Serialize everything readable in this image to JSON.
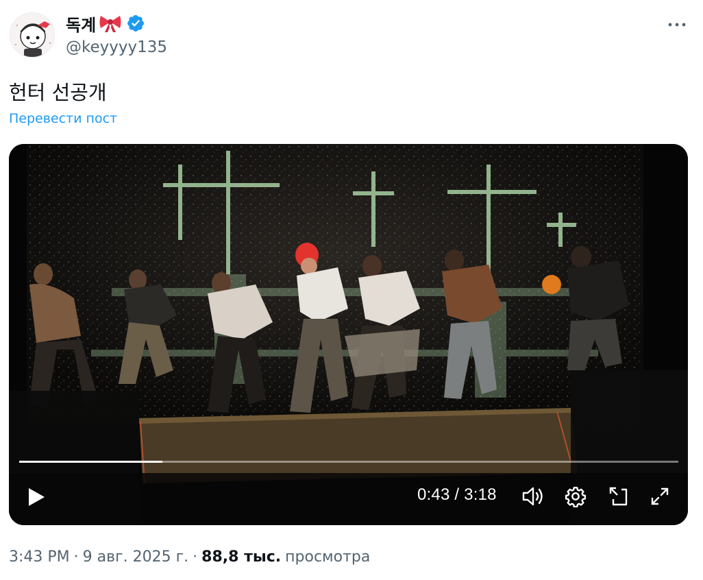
{
  "author": {
    "display_name": "독계",
    "emoji": "bow",
    "verified": true,
    "handle": "@keyyyy135",
    "avatar_icon": "cartoon-character-avatar"
  },
  "post": {
    "text": "헌터 선공개",
    "translate_label": "Перевести пост"
  },
  "video": {
    "current_time": "0:43",
    "separator": "/",
    "duration": "3:18",
    "progress": 0.217,
    "icons": [
      "play-icon",
      "volume-icon",
      "settings-icon",
      "pip-icon",
      "fullscreen-icon"
    ]
  },
  "meta": {
    "time": "3:43 PM",
    "dot1": "·",
    "date": "9 авг. 2025 г.",
    "dot2": "·",
    "views_count": "88,8 тыс.",
    "views_label": "просмотра"
  },
  "colors": {
    "link": "#1d9bf0",
    "verified": "#1d9bf0",
    "secondary_text": "#536471",
    "primary_text": "#0f1419"
  }
}
